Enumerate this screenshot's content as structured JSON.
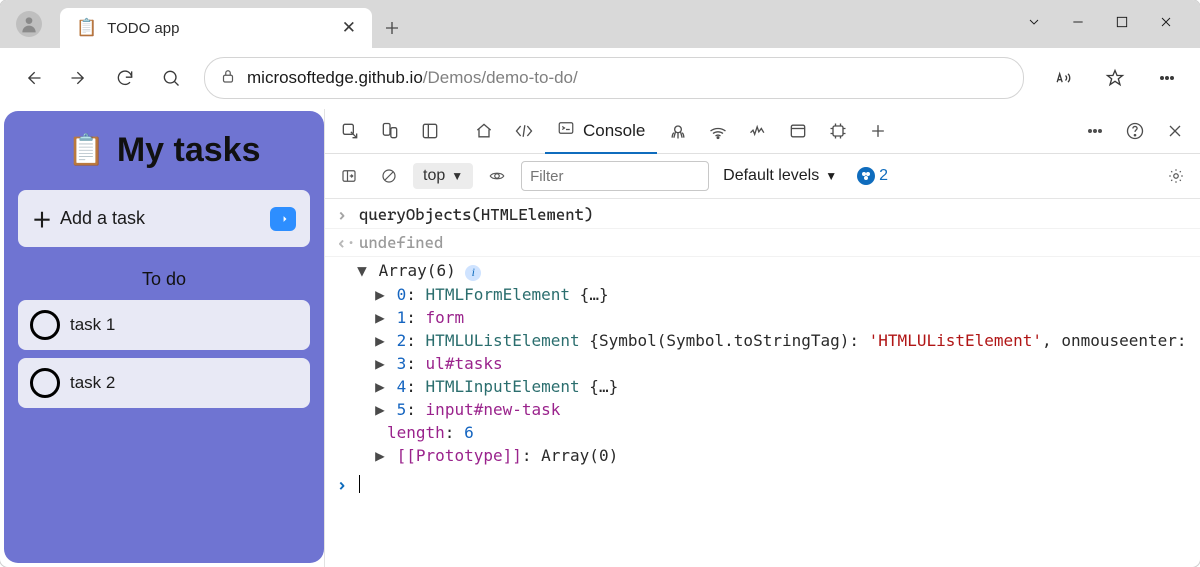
{
  "tab": {
    "title": "TODO app",
    "favicon": "📋"
  },
  "url": {
    "host": "microsoftedge.github.io",
    "rest": "/Demos/demo-to-do/"
  },
  "page": {
    "heading": "My tasks",
    "add_placeholder": "Add a task",
    "section": "To do",
    "tasks": [
      "task 1",
      "task 2"
    ]
  },
  "devtools": {
    "console_tab": "Console",
    "context": "top",
    "filter_placeholder": "Filter",
    "levels": "Default levels",
    "issues": "2"
  },
  "console": {
    "input": "queryObjects(HTMLElement)",
    "return": "undefined",
    "array_label": "Array(6)",
    "items": {
      "i0": {
        "idx": "0",
        "sep": ": ",
        "type": "HTMLFormElement",
        "suffix": " {…}"
      },
      "i1": {
        "idx": "1",
        "sep": ": ",
        "val": "form"
      },
      "i2": {
        "idx": "2",
        "sep": ": ",
        "type": "HTMLUListElement",
        "mid": " {Symbol(Symbol.toStringTag): ",
        "str": "'HTMLUListElement'",
        "trail": ", onmouseenter:"
      },
      "i3": {
        "idx": "3",
        "sep": ": ",
        "val": "ul#tasks"
      },
      "i4": {
        "idx": "4",
        "sep": ": ",
        "type": "HTMLInputElement",
        "suffix": " {…}"
      },
      "i5": {
        "idx": "5",
        "sep": ": ",
        "val": "input#new-task"
      },
      "len_key": "length",
      "len_sep": ": ",
      "len_val": "6",
      "proto_key": "[[Prototype]]",
      "proto_sep": ": ",
      "proto_val": "Array(0)"
    }
  }
}
